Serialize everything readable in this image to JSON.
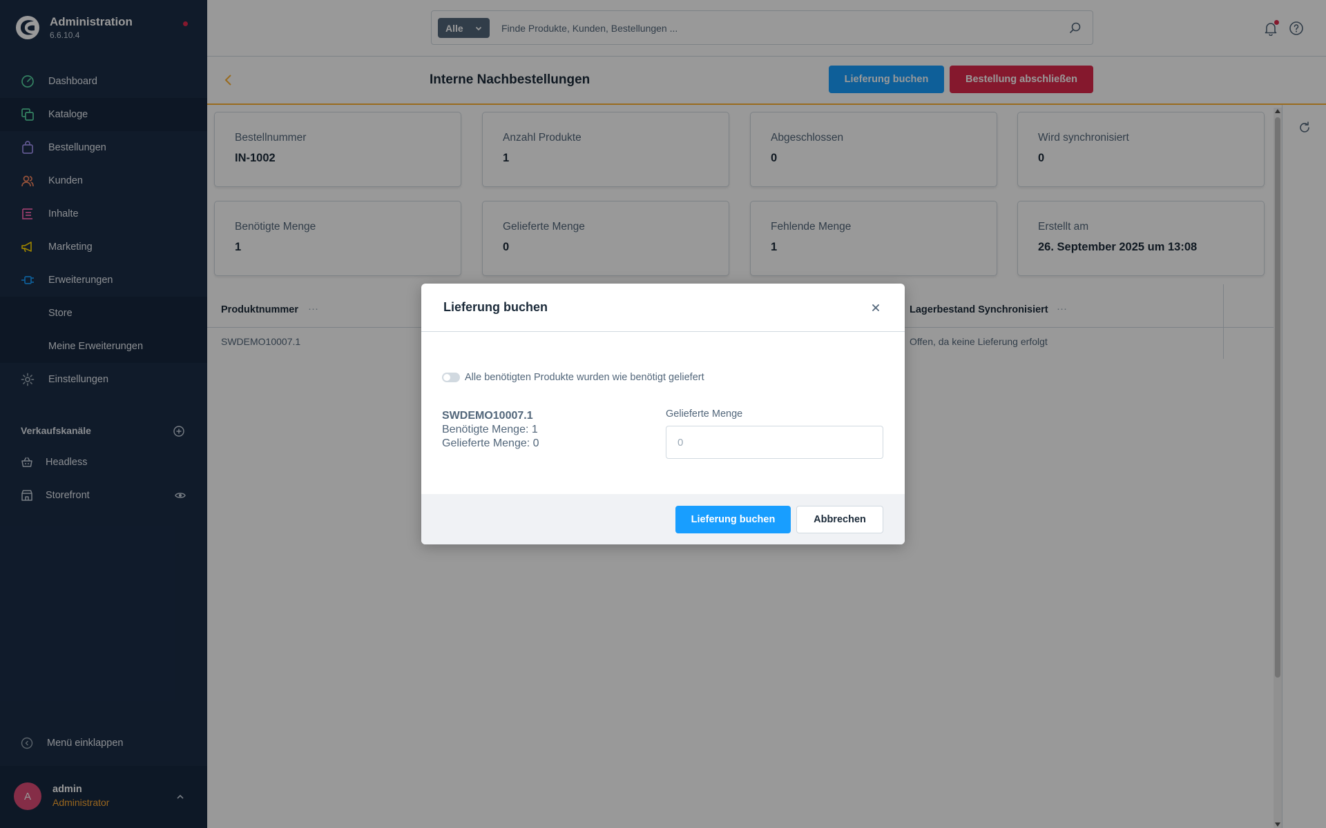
{
  "app": {
    "title": "Administration",
    "version": "6.6.10.4"
  },
  "sidebar": {
    "items": [
      {
        "label": "Dashboard",
        "icon": "dashboard-icon",
        "color": "#57d9a3"
      },
      {
        "label": "Kataloge",
        "icon": "catalog-icon",
        "color": "#57d9a3",
        "active": true
      },
      {
        "label": "Bestellungen",
        "icon": "bag-icon",
        "color": "#a092f0"
      },
      {
        "label": "Kunden",
        "icon": "users-icon",
        "color": "#f88962"
      },
      {
        "label": "Inhalte",
        "icon": "content-icon",
        "color": "#ff68b4"
      },
      {
        "label": "Marketing",
        "icon": "megaphone-icon",
        "color": "#ffd700"
      },
      {
        "label": "Erweiterungen",
        "icon": "plugin-icon",
        "color": "#189eff",
        "expanded": true
      },
      {
        "label": "Einstellungen",
        "icon": "gear-icon",
        "color": "#9aa8b5"
      }
    ],
    "sub_items": [
      "Store",
      "Meine Erweiterungen"
    ],
    "sales_channels_title": "Verkaufskanäle",
    "sales_channels": [
      {
        "label": "Headless",
        "icon": "basket-icon"
      },
      {
        "label": "Storefront",
        "icon": "storefront-icon"
      }
    ],
    "collapse_label": "Menü einklappen",
    "user": {
      "initial": "A",
      "name": "admin",
      "role": "Administrator"
    }
  },
  "search": {
    "type": "Alle",
    "placeholder": "Finde Produkte, Kunden, Bestellungen ..."
  },
  "page": {
    "title": "Interne Nachbestellungen",
    "actions": {
      "book_delivery": "Lieferung buchen",
      "complete_order": "Bestellung abschließen"
    }
  },
  "stats": [
    {
      "label": "Bestellnummer",
      "value": "IN-1002"
    },
    {
      "label": "Anzahl Produkte",
      "value": "1"
    },
    {
      "label": "Abgeschlossen",
      "value": "0"
    },
    {
      "label": "Wird synchronisiert",
      "value": "0"
    },
    {
      "label": "Benötigte Menge",
      "value": "1"
    },
    {
      "label": "Gelieferte Menge",
      "value": "0"
    },
    {
      "label": "Fehlende Menge",
      "value": "1"
    },
    {
      "label": "Erstellt am",
      "value": "26. September 2025 um 13:08"
    }
  ],
  "grid": {
    "columns": [
      "Produktnummer",
      "Lagerbestand Synchronisiert"
    ],
    "rows": [
      {
        "product_number": "SWDEMO10007.1",
        "stock_sync": "Offen, da keine Lieferung erfolgt"
      }
    ]
  },
  "modal": {
    "title": "Lieferung buchen",
    "toggle_label": "Alle benötigten Produkte wurden wie benötigt geliefert",
    "toggle_on": false,
    "product_number": "SWDEMO10007.1",
    "required_line": "Benötigte Menge: 1",
    "delivered_line": "Gelieferte Menge: 0",
    "field_label": "Gelieferte Menge",
    "field_placeholder": "0",
    "confirm_label": "Lieferung buchen",
    "cancel_label": "Abbrechen"
  },
  "colors": {
    "sidebar_bg": "#1b2d47",
    "primary": "#189eff",
    "danger": "#de294c",
    "accent": "#ffb233"
  }
}
